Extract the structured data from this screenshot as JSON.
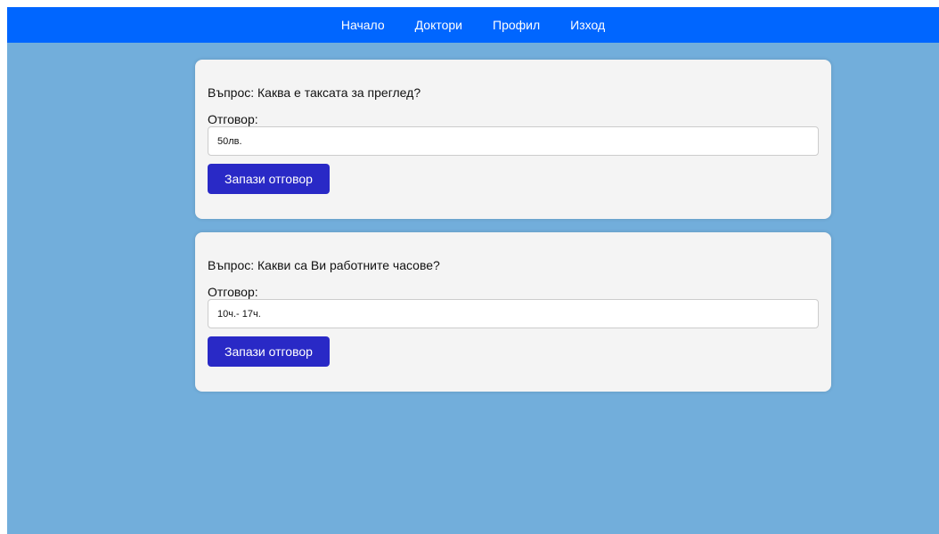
{
  "nav": {
    "items": [
      {
        "label": "Начало"
      },
      {
        "label": "Доктори"
      },
      {
        "label": "Профил"
      },
      {
        "label": "Изход"
      }
    ]
  },
  "faq": [
    {
      "question": "Въпрос: Каква е таксата за преглед?",
      "answer_label": "Отговор:",
      "answer_value": "50лв.",
      "save_label": "Запази отговор"
    },
    {
      "question": "Въпрос: Какви са Ви работните часове?",
      "answer_label": "Отговор:",
      "answer_value": "10ч.- 17ч.",
      "save_label": "Запази отговор"
    }
  ],
  "colors": {
    "navbar": "#0066ff",
    "background": "#72aedb",
    "card": "#f4f4f4",
    "button": "#2929c6"
  }
}
